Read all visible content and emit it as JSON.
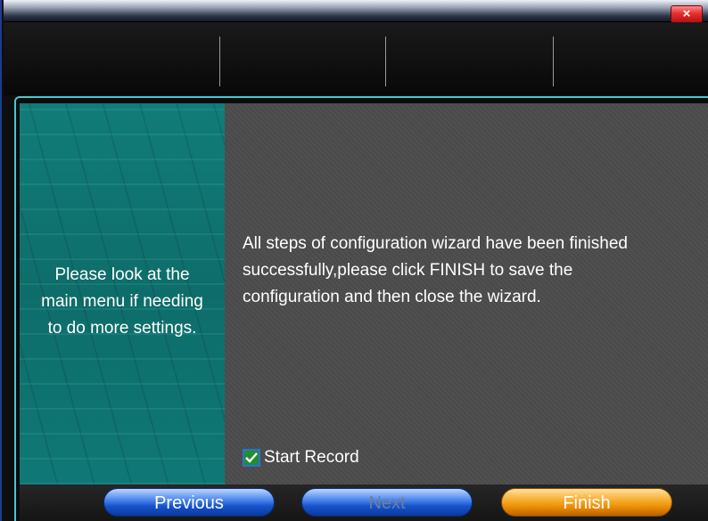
{
  "window": {
    "close_icon": "×"
  },
  "left_panel": {
    "text": "Please look at the\nmain menu if needing\nto do more settings."
  },
  "main": {
    "message": "  All steps of configuration wizard have been finished successfully,please click FINISH to save the configuration and then close the wizard.",
    "start_record": {
      "label": "Start Record",
      "checked": true
    }
  },
  "buttons": {
    "previous": "Previous",
    "next": "Next",
    "finish": "Finish"
  },
  "colors": {
    "accent_border": "#46c8d2",
    "left_panel": "#0f7572",
    "button_blue": "#1552cc",
    "button_orange": "#f7b034"
  }
}
